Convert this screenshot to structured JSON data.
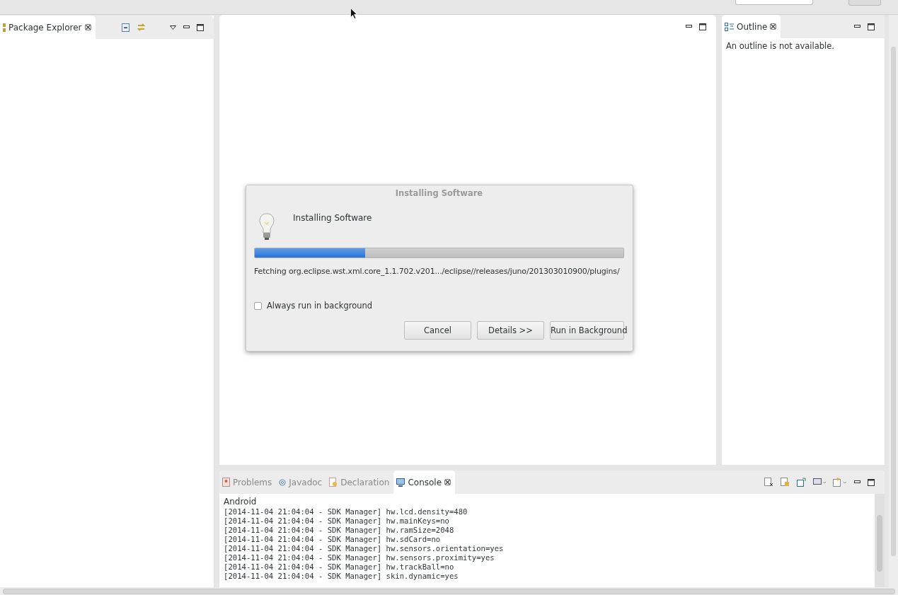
{
  "package_explorer": {
    "title": "Package Explorer"
  },
  "outline": {
    "title": "Outline",
    "message": "An outline is not available."
  },
  "console": {
    "tabs": [
      {
        "label": "Problems",
        "selected": false
      },
      {
        "label": "Javadoc",
        "selected": false
      },
      {
        "label": "Declaration",
        "selected": false
      },
      {
        "label": "Console",
        "selected": true
      }
    ],
    "header": "Android",
    "lines": [
      "[2014-11-04 21:04:04 - SDK Manager] hw.lcd.density=480",
      "[2014-11-04 21:04:04 - SDK Manager] hw.mainKeys=no",
      "[2014-11-04 21:04:04 - SDK Manager] hw.ramSize=2048",
      "[2014-11-04 21:04:04 - SDK Manager] hw.sdCard=no",
      "[2014-11-04 21:04:04 - SDK Manager] hw.sensors.orientation=yes",
      "[2014-11-04 21:04:04 - SDK Manager] hw.sensors.proximity=yes",
      "[2014-11-04 21:04:04 - SDK Manager] hw.trackBall=no",
      "[2014-11-04 21:04:04 - SDK Manager] skin.dynamic=yes"
    ]
  },
  "dialog": {
    "title": "Installing Software",
    "heading": "Installing Software",
    "progress": {
      "level": 0.3
    },
    "status": "Fetching org.eclipse.wst.xml.core_1.1.702.v201.../eclipse//releases/juno/201303010900/plugins/",
    "always_background": {
      "label": "Always run in background",
      "checked": false
    },
    "buttons": [
      "Cancel",
      "Details >>",
      "Run in Background"
    ]
  }
}
